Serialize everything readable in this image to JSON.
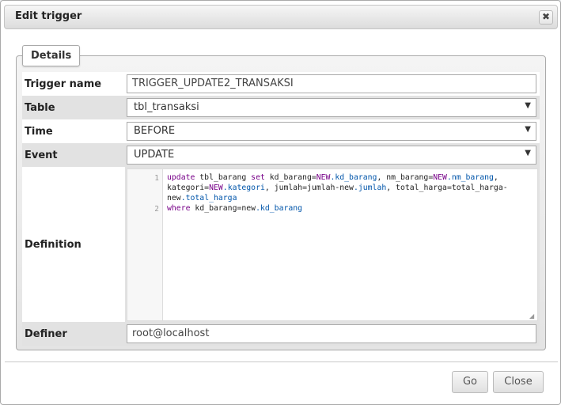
{
  "dialog": {
    "title": "Edit trigger",
    "close_glyph": "✖",
    "section_legend": "Details"
  },
  "fields": {
    "trigger_name": {
      "label": "Trigger name",
      "value": "TRIGGER_UPDATE2_TRANSAKSI"
    },
    "table": {
      "label": "Table",
      "value": "tbl_transaksi"
    },
    "time": {
      "label": "Time",
      "value": "BEFORE"
    },
    "event": {
      "label": "Event",
      "value": "UPDATE"
    },
    "definition": {
      "label": "Definition",
      "line_numbers": [
        "1",
        "2"
      ]
    },
    "definer": {
      "label": "Definer",
      "value": "root@localhost"
    }
  },
  "code": {
    "l1a_kw": "update",
    "l1a_t1": " tbl_barang ",
    "l1a_kw2": "set",
    "l1a_t2": " kd_barang=",
    "l1a_new1": "NEW",
    "l1a_f1": ".kd_barang",
    "l1a_t3": ", nm_barang=",
    "l1a_new2": "NEW",
    "l1a_f2": ".nm_barang",
    "l1a_t4": ",",
    "l1b_t1": "kategori=",
    "l1b_new": "NEW",
    "l1b_f": ".kategori",
    "l1b_t2": ", jumlah=jumlah-new",
    "l1b_f2": ".jumlah",
    "l1b_t3": ", total_harga=total_harga-",
    "l1c_t1": "new",
    "l1c_f": ".total_harga",
    "l2_kw": "where",
    "l2_t1": " kd_barang=new",
    "l2_f": ".kd_barang"
  },
  "buttons": {
    "go": "Go",
    "close": "Close"
  },
  "icons": {
    "close": "close-icon",
    "select_arrow": "chevron-down-icon",
    "resize": "resize-grip-icon"
  }
}
